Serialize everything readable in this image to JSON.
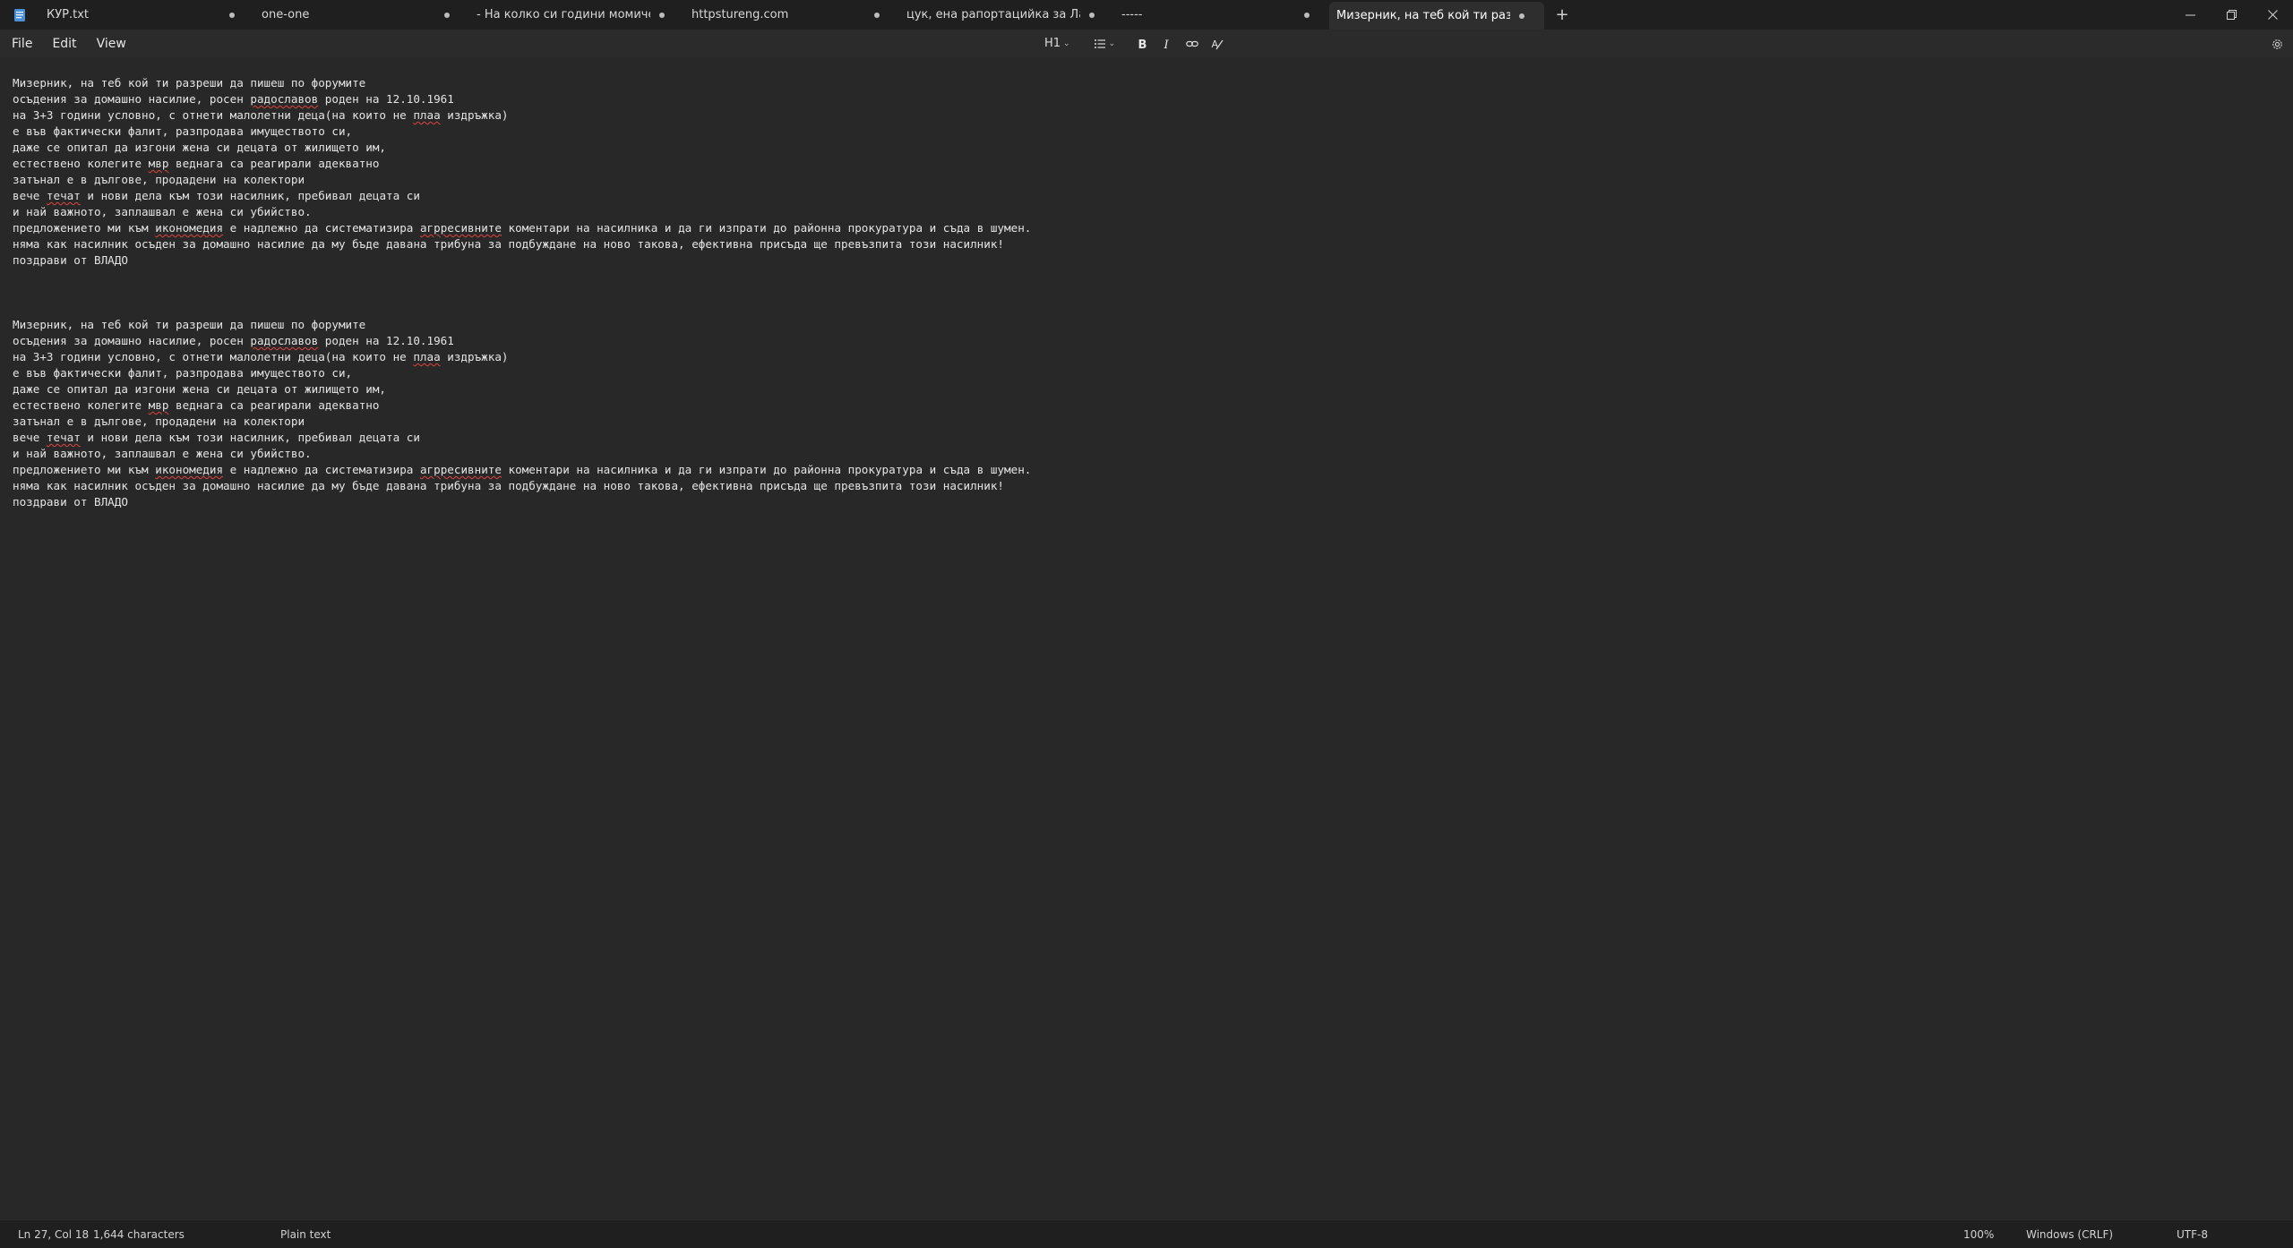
{
  "window": {
    "tabs": [
      {
        "title": "КУР.txt",
        "unsaved": true,
        "active": false
      },
      {
        "title": "one-one",
        "unsaved": true,
        "active": false
      },
      {
        "title": "- На колко си години момиче",
        "unsaved": true,
        "active": false
      },
      {
        "title": "httpstureng.com",
        "unsaved": true,
        "active": false
      },
      {
        "title": "цук, ена рапортацийка за Лайняно",
        "unsaved": true,
        "active": false
      },
      {
        "title": "-----",
        "unsaved": true,
        "active": false
      },
      {
        "title": "Мизерник, на теб кой ти разреши",
        "unsaved": true,
        "active": true
      }
    ],
    "new_tab_label": "+",
    "controls": [
      "minimize-icon",
      "restore-icon",
      "close-icon"
    ]
  },
  "menu": {
    "items": [
      "File",
      "Edit",
      "View"
    ]
  },
  "toolbar": {
    "heading_label": "H1",
    "list_icon": "bullet-list-icon",
    "bold_icon": "bold-icon",
    "italic_icon": "italic-icon",
    "link_icon": "link-icon",
    "clear_format_icon": "clear-formatting-icon",
    "settings_icon": "gear-icon"
  },
  "document": {
    "lines": [
      [
        {
          "t": "Мизерник, на теб кой ти разреши да пишеш по форумите"
        }
      ],
      [
        {
          "t": "осъдения за домашно насилие, росен "
        },
        {
          "t": "радославов",
          "spell": true
        },
        {
          "t": " роден на 12.10.1961"
        }
      ],
      [
        {
          "t": "на 3+3 години условно, с отнети малолетни деца(на които не "
        },
        {
          "t": "плаа",
          "spell": true
        },
        {
          "t": " издръжка)"
        }
      ],
      [
        {
          "t": "е във фактически фалит, разпродава имуществото си,"
        }
      ],
      [
        {
          "t": "даже се опитал да изгони жена си децата от жилището им,"
        }
      ],
      [
        {
          "t": "естествено колегите "
        },
        {
          "t": "мвр",
          "spell": true
        },
        {
          "t": " веднага са реагирали адекватно"
        }
      ],
      [
        {
          "t": "затънал е в дългове, продадени на колектори"
        }
      ],
      [
        {
          "t": "вече "
        },
        {
          "t": "течат",
          "spell": true
        },
        {
          "t": " и нови дела към този насилник, пребивал децата си"
        }
      ],
      [
        {
          "t": "и най важното, заплашвал е жена си убийство."
        }
      ],
      [
        {
          "t": "предложението ми към "
        },
        {
          "t": "икономедия",
          "spell": true
        },
        {
          "t": " е надлежно да систематизира "
        },
        {
          "t": "агрресивните",
          "spell": true
        },
        {
          "t": " коментари на насилника и да ги изпрати до районна прокуратура и съда в шумен."
        }
      ],
      [
        {
          "t": "няма как насилник осъден за домашно насилие да му бъде давана трибуна за подбуждане на ново такова, ефективна присъда ще превъзпита този насилник!"
        }
      ],
      [
        {
          "t": "поздрави от ВЛАДО"
        }
      ],
      [
        {
          "t": ""
        }
      ],
      [
        {
          "t": ""
        }
      ],
      [
        {
          "t": ""
        }
      ],
      [
        {
          "t": "Мизерник, на теб кой ти разреши да пишеш по форумите"
        }
      ],
      [
        {
          "t": "осъдения за домашно насилие, росен "
        },
        {
          "t": "радославов",
          "spell": true
        },
        {
          "t": " роден на 12.10.1961"
        }
      ],
      [
        {
          "t": "на 3+3 години условно, с отнети малолетни деца(на които не "
        },
        {
          "t": "плаа",
          "spell": true
        },
        {
          "t": " издръжка)"
        }
      ],
      [
        {
          "t": "е във фактически фалит, разпродава имуществото си,"
        }
      ],
      [
        {
          "t": "даже се опитал да изгони жена си децата от жилището им,"
        }
      ],
      [
        {
          "t": "естествено колегите "
        },
        {
          "t": "мвр",
          "spell": true
        },
        {
          "t": " веднага са реагирали адекватно"
        }
      ],
      [
        {
          "t": "затънал е в дългове, продадени на колектори"
        }
      ],
      [
        {
          "t": "вече "
        },
        {
          "t": "течат",
          "spell": true
        },
        {
          "t": " и нови дела към този насилник, пребивал децата си"
        }
      ],
      [
        {
          "t": "и най важното, заплашвал е жена си убийство."
        }
      ],
      [
        {
          "t": "предложението ми към "
        },
        {
          "t": "икономедия",
          "spell": true
        },
        {
          "t": " е надлежно да систематизира "
        },
        {
          "t": "агрресивните",
          "spell": true
        },
        {
          "t": " коментари на насилника и да ги изпрати до районна прокуратура и съда в шумен."
        }
      ],
      [
        {
          "t": "няма как насилник осъден за домашно насилие да му бъде давана трибуна за подбуждане на ново такова, ефективна присъда ще превъзпита този насилник!"
        }
      ],
      [
        {
          "t": "поздрави от ВЛАДО"
        }
      ]
    ]
  },
  "status": {
    "position": "Ln 27, Col 18",
    "characters": "1,644 characters",
    "format": "Plain text",
    "zoom": "100%",
    "line_ending": "Windows (CRLF)",
    "encoding": "UTF-8"
  }
}
